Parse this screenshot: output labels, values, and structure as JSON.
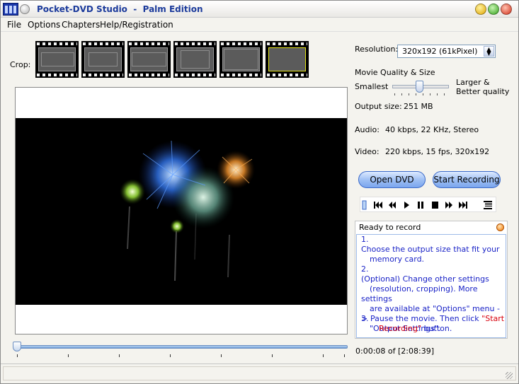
{
  "window": {
    "title": "Pocket-DVD Studio  -  Palm Edition",
    "controls": [
      "minimize",
      "maximize",
      "close"
    ]
  },
  "menu": [
    {
      "label": "File"
    },
    {
      "label": "Options"
    },
    {
      "label": "Chapters"
    },
    {
      "label": "Help/Registration"
    }
  ],
  "crop": {
    "label": "Crop:",
    "thumbnails": [
      {
        "id": "crop-1",
        "selected": false
      },
      {
        "id": "crop-2",
        "selected": false
      },
      {
        "id": "crop-3",
        "selected": false
      },
      {
        "id": "crop-4",
        "selected": false
      },
      {
        "id": "crop-5",
        "selected": false
      },
      {
        "id": "crop-6",
        "selected": true
      }
    ]
  },
  "settings": {
    "resolution_label": "Resolution:",
    "resolution_value": "320x192  (61kPixel)",
    "quality_label": "Movie Quality & Size",
    "quality_min": "Smallest",
    "quality_max_line1": "Larger &",
    "quality_max_line2": "Better quality",
    "quality_level": 0.48,
    "output_size_label": "Output size:",
    "output_size_value": "251 MB",
    "audio_label": "Audio:",
    "audio_value": "40 kbps, 22 KHz, Stereo",
    "video_label": "Video:",
    "video_value": "220 kbps, 15 fps, 320x192"
  },
  "buttons": {
    "open_dvd": "Open DVD",
    "start_recording": "Start Recording"
  },
  "player_controls": [
    "position-marker",
    "skip-to-start",
    "rewind",
    "play",
    "pause",
    "stop",
    "fast-forward",
    "skip-to-end",
    "chapter-list"
  ],
  "status": {
    "header": "Ready to record",
    "steps": [
      {
        "num": "1.",
        "lines": [
          "Choose the output size that fit your",
          "memory card."
        ]
      },
      {
        "num": "2.",
        "lines": [
          "(Optional) Change other settings",
          "(resolution, cropping). More settings",
          "are available at \"Options\" menu ->",
          "\"Output Settings\"."
        ]
      },
      {
        "num": "3.",
        "line1": "Pause the movie. Then click ",
        "line1_red": "\"Start",
        "line2_red": "Recording\"",
        "line2": " button."
      }
    ]
  },
  "playback": {
    "time": "0:00:08 of [2:08:39]",
    "position": 0.001
  },
  "colors": {
    "title_text": "#1b3a9b",
    "instruction_text": "#1a23c7",
    "highlight_red": "#d8000c",
    "button_blue": "#9bbdf3"
  }
}
